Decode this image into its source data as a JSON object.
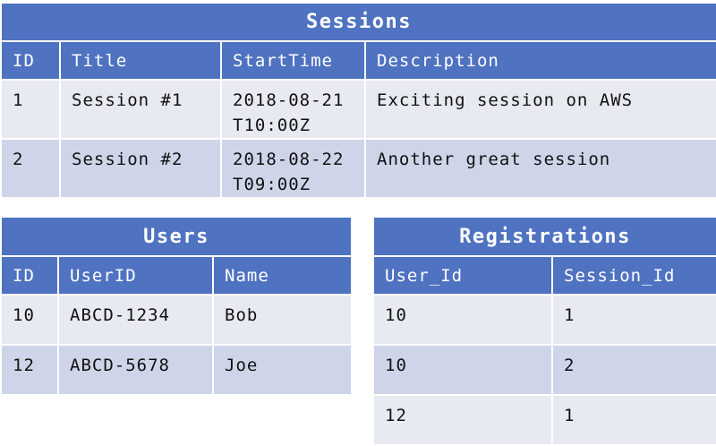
{
  "sessions": {
    "title": "Sessions",
    "headers": [
      "ID",
      "Title",
      "StartTime",
      "Description"
    ],
    "rows": [
      [
        "1",
        "Session #1",
        "2018-08-21T10:00Z",
        "Exciting session on AWS"
      ],
      [
        "2",
        "Session #2",
        "2018-08-22T09:00Z",
        "Another great session"
      ]
    ]
  },
  "users": {
    "title": "Users",
    "headers": [
      "ID",
      "UserID",
      "Name"
    ],
    "rows": [
      [
        "10",
        "ABCD-1234",
        "Bob"
      ],
      [
        "12",
        "ABCD-5678",
        "Joe"
      ]
    ]
  },
  "registrations": {
    "title": "Registrations",
    "headers": [
      "User_Id",
      "Session_Id"
    ],
    "rows": [
      [
        "10",
        "1"
      ],
      [
        "10",
        "2"
      ],
      [
        "12",
        "1"
      ]
    ]
  },
  "colors": {
    "header": "#4f72c1",
    "row_light": "#e8eaf2",
    "row_dark": "#cfd5e9"
  }
}
